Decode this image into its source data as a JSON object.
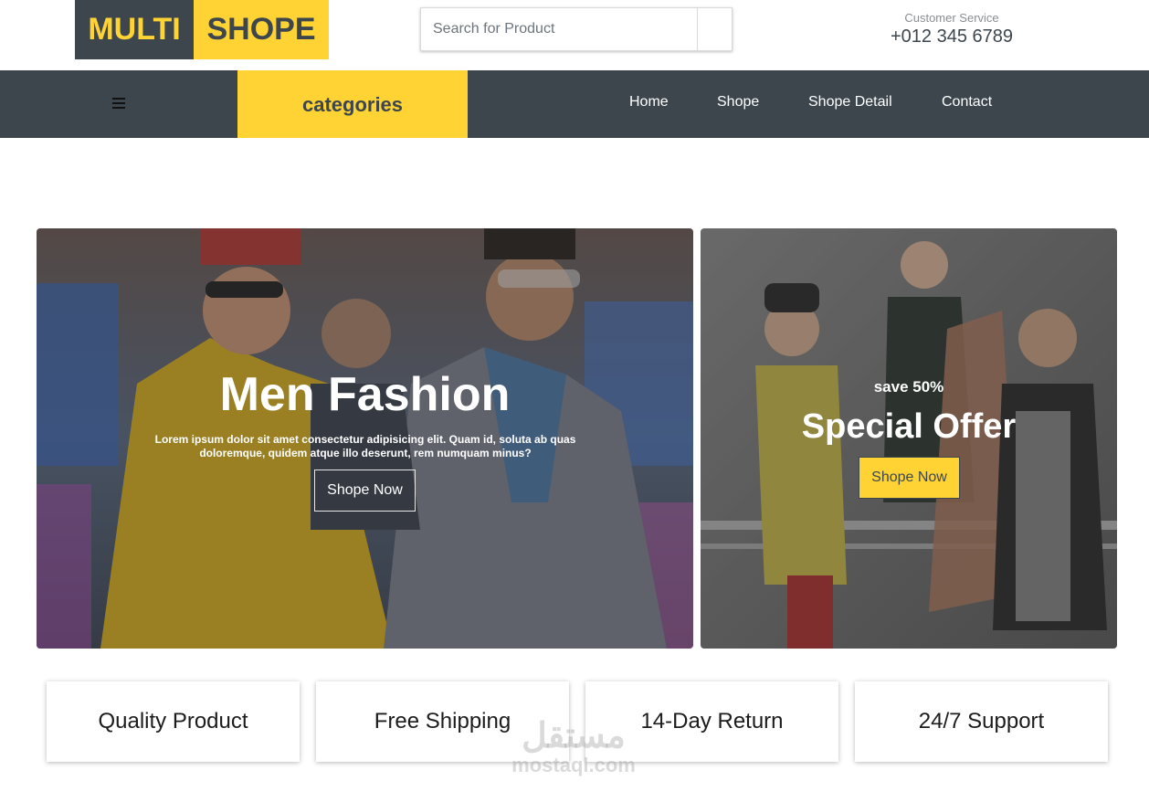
{
  "header": {
    "logo_part1": "MULTI",
    "logo_part2": "SHOPE",
    "search_placeholder": "Search for Product",
    "service_label": "Customer Service",
    "service_phone": "+012 345 6789"
  },
  "nav": {
    "menu_icon": "hamburger-icon",
    "categories_label": "categories",
    "links": [
      "Home",
      "Shope",
      "Shope Detail",
      "Contact"
    ]
  },
  "hero_main": {
    "title": "Men Fashion",
    "text": "Lorem ipsum dolor sit amet consectetur adipisicing elit. Quam id, soluta ab quas doloremque, quidem atque illo deserunt, rem numquam minus?",
    "button_label": "Shope Now"
  },
  "hero_side": {
    "save_text": "save 50%",
    "title": "Special Offer",
    "button_label": "Shope Now"
  },
  "features": [
    "Quality Product",
    "Free Shipping",
    "14-Day Return",
    "24/7 Support"
  ],
  "watermark": {
    "line1": "مستقل",
    "line2": "mostaql.com"
  },
  "colors": {
    "accent": "#ffd333",
    "dark": "#3d464d"
  }
}
